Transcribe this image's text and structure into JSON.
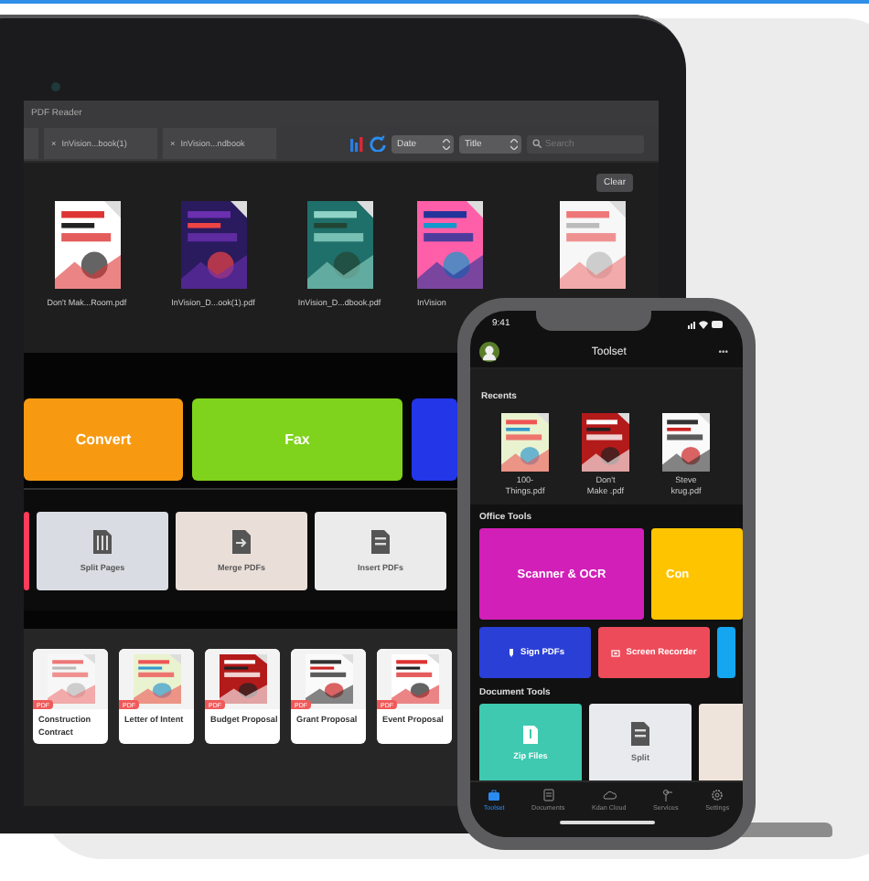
{
  "tablet": {
    "app_title": "PDF Reader",
    "tabs": [
      {
        "close": "×",
        "label": "InVision...book(1)"
      },
      {
        "close": "×",
        "label": "InVision...ndbook"
      }
    ],
    "sort_options": [
      "Date",
      "Title"
    ],
    "search": {
      "placeholder": "Search"
    },
    "clear_button": "Clear",
    "files": [
      {
        "label": "Don't Mak...Room.pdf"
      },
      {
        "label": "InVision_D...ook(1).pdf"
      },
      {
        "label": "InVision_D...dbook.pdf"
      },
      {
        "label": "InVision"
      },
      {
        "kind": "picture"
      }
    ],
    "feature_cards": [
      {
        "label": "Convert",
        "color": "#f79a12"
      },
      {
        "label": "Fax",
        "color": "#7fd31c"
      },
      {
        "color": "#2336e8"
      }
    ],
    "tools": [
      {
        "color": "#ff3b5c"
      },
      {
        "label": "Split Pages",
        "color": "#d9dde3"
      },
      {
        "label": "Merge PDFs",
        "color": "#eadfd8"
      },
      {
        "label": "Insert PDFs",
        "color": "#ebebeb"
      }
    ],
    "templates": [
      {
        "badge": "PDF",
        "title": "Construction Contract"
      },
      {
        "badge": "PDF",
        "title": "Letter of Intent"
      },
      {
        "badge": "PDF",
        "title": "Budget Proposal"
      },
      {
        "badge": "PDF",
        "title": "Grant Proposal"
      },
      {
        "badge": "PDF",
        "title": "Event Proposal"
      }
    ]
  },
  "phone": {
    "time": "9:41",
    "title": "Toolset",
    "more": "•••",
    "recents_heading": "Recents",
    "recents": [
      {
        "label": "100-\nThings.pdf"
      },
      {
        "label": "Don't\nMake .pdf"
      },
      {
        "label": "Steve\nkrug.pdf"
      }
    ],
    "office_tools_heading": "Office Tools",
    "office_tools": [
      {
        "label": "Scanner & OCR",
        "color": "#d21fb8"
      },
      {
        "label": "Con",
        "color": "#ffc400"
      }
    ],
    "quick_tools": [
      {
        "label": "Sign PDFs",
        "color": "#2a3fd6"
      },
      {
        "label": "Screen Recorder",
        "color": "#ee4b5a"
      },
      {
        "color": "#14a6f0"
      }
    ],
    "document_tools_heading": "Document Tools",
    "document_tools": [
      {
        "label": "Zip Files",
        "color": "#3ec9b0"
      },
      {
        "label": "Split",
        "color": "#e8eaee"
      },
      {
        "color": "#efe4dc"
      }
    ],
    "tab_bar": [
      {
        "label": "Toolset",
        "selected": true
      },
      {
        "label": "Documents",
        "selected": false
      },
      {
        "label": "Kdan Cloud",
        "selected": false
      },
      {
        "label": "Services",
        "selected": false
      },
      {
        "label": "Settings",
        "selected": false
      }
    ]
  }
}
